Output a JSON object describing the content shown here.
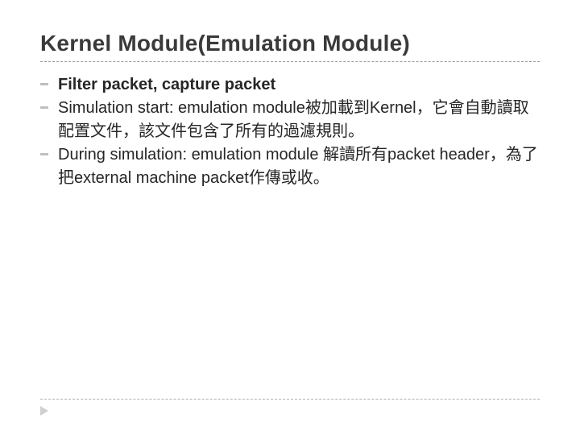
{
  "title": "Kernel Module(Emulation Module)",
  "bullets": [
    {
      "text": "Filter packet, capture packet",
      "bold": true
    },
    {
      "text": "Simulation start: emulation module被加載到Kernel，它會自動讀取配置文件，該文件包含了所有的過濾規則。",
      "bold": false
    },
    {
      "text": "During simulation: emulation module 解讀所有packet header，為了把external machine packet作傳或收。",
      "bold": false
    }
  ]
}
